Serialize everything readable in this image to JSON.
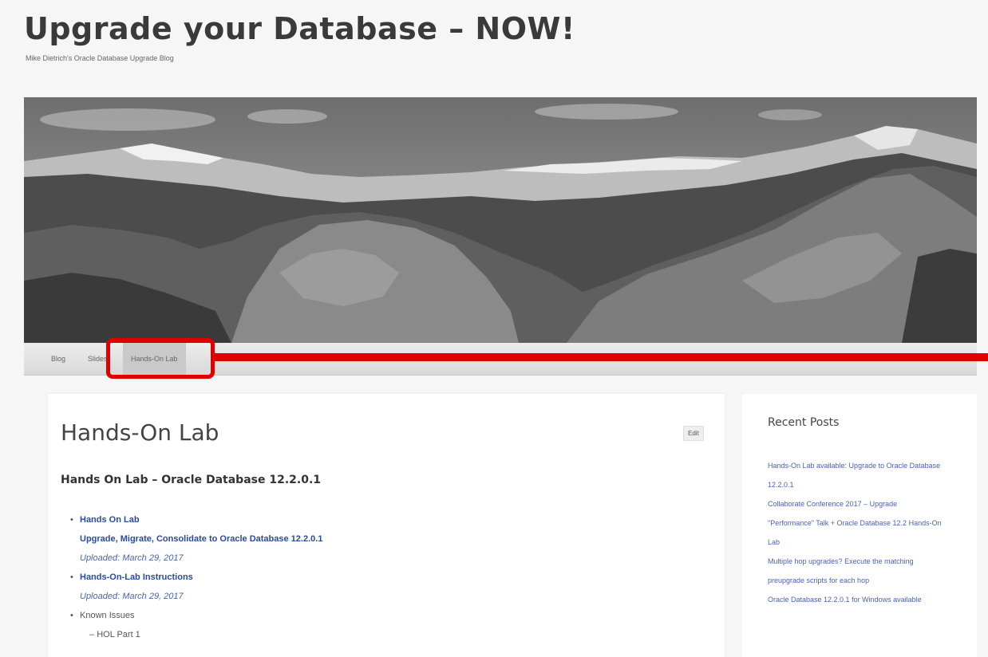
{
  "site": {
    "title": "Upgrade your Database – NOW!",
    "description": "Mike Dietrich's Oracle Database Upgrade Blog"
  },
  "nav": {
    "items": [
      {
        "label": "Blog"
      },
      {
        "label": "Slides"
      },
      {
        "label": "Hands-On Lab",
        "active": true
      }
    ]
  },
  "page": {
    "title": "Hands-On Lab",
    "edit_label": "Edit",
    "section_heading": "Hands On Lab – Oracle Database 12.2.0.1",
    "downloads": [
      {
        "title": "Hands On Lab",
        "subtitle": "Upgrade, Migrate, Consolidate to Oracle Database 12.2.0.1",
        "uploaded": "Uploaded: March 29, 2017"
      },
      {
        "title": "Hands-On-Lab Instructions",
        "uploaded": "Uploaded: March 29, 2017"
      }
    ],
    "known_issues": {
      "label": "Known Issues",
      "items": [
        "HOL Part 1"
      ]
    }
  },
  "sidebar": {
    "title": "Recent Posts",
    "posts": [
      "Hands-On Lab available: Upgrade to Oracle Database 12.2.0.1",
      "Collaborate Conference 2017 – Upgrade \"Performance\" Talk + Oracle Database 12.2 Hands-On Lab",
      "Multiple hop upgrades? Execute the matching preupgrade scripts for each hop",
      "Oracle Database 12.2.0.1 for Windows available"
    ]
  },
  "colors": {
    "highlight": "#e00000",
    "link": "#2a4a9a"
  }
}
